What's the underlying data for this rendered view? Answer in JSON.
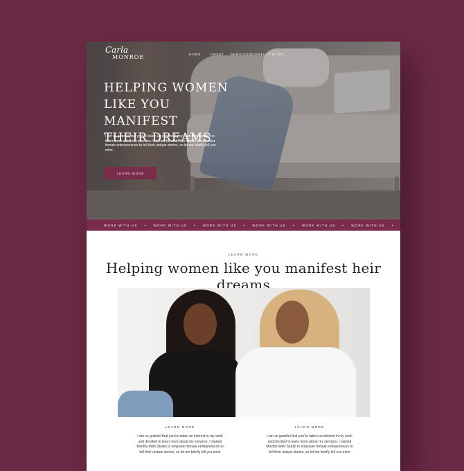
{
  "brand": {
    "script": "Carla",
    "name": "MONROE"
  },
  "nav": [
    "HOME",
    "ABOUT",
    "SERVICES",
    "CONTACT",
    "BLOG"
  ],
  "hero": {
    "title_lines": [
      "HELPING WOMEN",
      "LIKE YOU MANIFEST",
      "THEIR DREAMS"
    ],
    "body": "I am so grateful that you've taken an interest in my work and decided to learn more about my services. I started Mindful Web Studio to empower female entrepreneurs to tell their unique stories, so let me briefly tell you mine.",
    "button": "LEARN MORE"
  },
  "marquee": {
    "text": "WORK WITH US",
    "count": 7
  },
  "section": {
    "kicker": "LEARN MORE",
    "title": "Helping women like you manifest heir dreams"
  },
  "columns": [
    {
      "kicker": "LEARN MORE",
      "text": "I am so grateful that you've taken an interest in my work and decided to learn more about my services. I started Mindful Web Studio to empower female entrepreneurs to tell their unique stories, so let me briefly tell you mine"
    },
    {
      "kicker": "LEARN MORE",
      "text": "I am so grateful that you've taken an interest in my work and decided to learn more about my services. I started Mindful Web Studio to empower female entrepreneurs to tell their unique stories, so let me briefly tell you mine"
    }
  ],
  "colors": {
    "background": "#6b2a45",
    "accent": "#7a2c4b",
    "white": "#ffffff"
  }
}
